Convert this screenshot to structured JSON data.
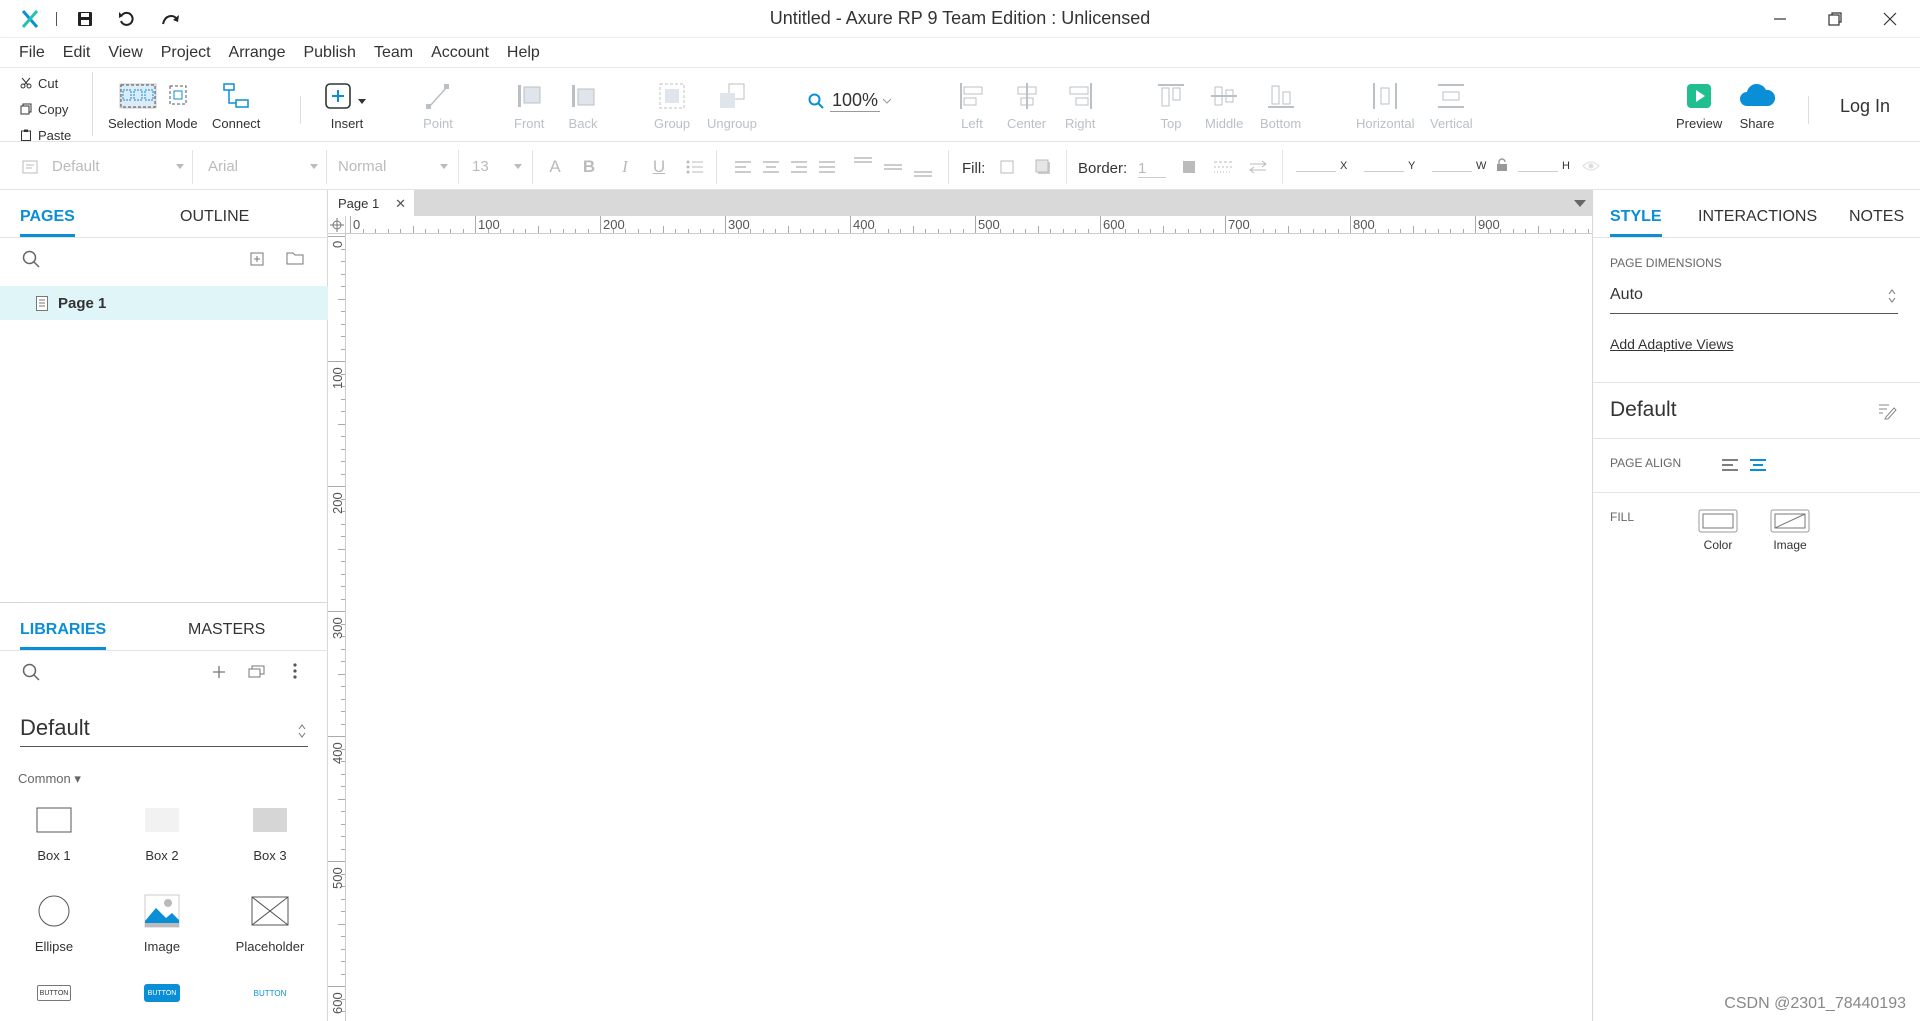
{
  "window": {
    "title": "Untitled - Axure RP 9 Team Edition : Unlicensed"
  },
  "menu": [
    "File",
    "Edit",
    "View",
    "Project",
    "Arrange",
    "Publish",
    "Team",
    "Account",
    "Help"
  ],
  "clipboard": {
    "cut": "Cut",
    "copy": "Copy",
    "paste": "Paste"
  },
  "toolbar": {
    "selection_mode": "Selection Mode",
    "connect": "Connect",
    "insert": "Insert",
    "point": "Point",
    "front": "Front",
    "back": "Back",
    "group": "Group",
    "ungroup": "Ungroup",
    "zoom": "100%",
    "left": "Left",
    "center": "Center",
    "right": "Right",
    "top": "Top",
    "middle": "Middle",
    "bottom": "Bottom",
    "horizontal": "Horizontal",
    "vertical": "Vertical",
    "preview": "Preview",
    "share": "Share",
    "login": "Log In"
  },
  "format": {
    "style": "Default",
    "font": "Arial",
    "weight": "Normal",
    "size": "13",
    "fill_label": "Fill:",
    "border_label": "Border:",
    "border_width": "1",
    "x": "X",
    "y": "Y",
    "w": "W",
    "h": "H"
  },
  "left_panel": {
    "tabs": {
      "pages": "PAGES",
      "outline": "OUTLINE"
    },
    "pages": [
      {
        "name": "Page 1"
      }
    ],
    "lib_tabs": {
      "libraries": "LIBRARIES",
      "masters": "MASTERS"
    },
    "library": "Default",
    "category": "Common ▾",
    "widgets": {
      "box1": "Box 1",
      "box2": "Box 2",
      "box3": "Box 3",
      "ellipse": "Ellipse",
      "image": "Image",
      "placeholder": "Placeholder",
      "btn_caption": "BUTTON"
    }
  },
  "canvas": {
    "tab": "Page 1",
    "ruler_h": [
      "0",
      "100",
      "200",
      "300",
      "400",
      "500",
      "600",
      "700",
      "800",
      "900"
    ],
    "ruler_v": [
      "0",
      "100",
      "200",
      "300",
      "400",
      "500",
      "600"
    ]
  },
  "right_panel": {
    "tabs": {
      "style": "STYLE",
      "interactions": "INTERACTIONS",
      "notes": "NOTES"
    },
    "page_dimensions_label": "PAGE DIMENSIONS",
    "page_dimensions": "Auto",
    "add_adaptive": "Add Adaptive Views",
    "style_name": "Default",
    "page_align_label": "PAGE ALIGN",
    "fill_label": "FILL",
    "fill_color": "Color",
    "fill_image": "Image"
  },
  "watermark": "CSDN @2301_78440193",
  "colors": {
    "accent": "#0a8fd6",
    "selected_row": "#e0f5f8",
    "preview_green": "#1fbf8f",
    "disabled": "#b9c0c6"
  }
}
